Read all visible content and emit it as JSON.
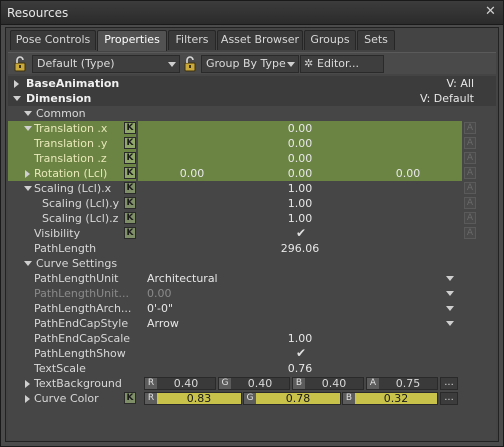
{
  "window": {
    "title": "Resources",
    "close_glyph": "✕"
  },
  "tabs": [
    {
      "label": "Pose Controls",
      "active": false
    },
    {
      "label": "Properties",
      "active": true
    },
    {
      "label": "Filters",
      "active": false
    },
    {
      "label": "Asset Browser",
      "active": false
    },
    {
      "label": "Groups",
      "active": false
    },
    {
      "label": "Sets",
      "active": false
    }
  ],
  "toolbar": {
    "filter_combo": "Default (Type)",
    "group_combo": "Group By Type",
    "editor_label": "Editor..."
  },
  "grid": {
    "base_animation": {
      "label": "BaseAnimation",
      "value": "V: All"
    },
    "dimension": {
      "label": "Dimension",
      "value": "V: Default"
    },
    "common_label": "Common",
    "translation_x": {
      "label": "Translation .x",
      "value": "0.00"
    },
    "translation_y": {
      "label": "Translation .y",
      "value": "0.00"
    },
    "translation_z": {
      "label": "Translation .z",
      "value": "0.00"
    },
    "rotation": {
      "label": "Rotation (Lcl)",
      "values": [
        "0.00",
        "0.00",
        "0.00"
      ]
    },
    "scaling_x": {
      "label": "Scaling (Lcl).x",
      "value": "1.00"
    },
    "scaling_y": {
      "label": "Scaling (Lcl).y",
      "value": "1.00"
    },
    "scaling_z": {
      "label": "Scaling (Lcl).z",
      "value": "1.00"
    },
    "visibility": {
      "label": "Visibility",
      "checked": true,
      "glyph": "✔"
    },
    "path_length": {
      "label": "PathLength",
      "value": "296.06"
    },
    "curve_settings_label": "Curve Settings",
    "path_length_unit": {
      "label": "PathLengthUnit",
      "value": "Architectural"
    },
    "path_length_unit_dim": {
      "label": "PathLengthUnit...",
      "value": "0.00"
    },
    "path_length_arch": {
      "label": "PathLengthArch...",
      "value": "0'-0\""
    },
    "path_end_cap_style": {
      "label": "PathEndCapStyle",
      "value": "Arrow"
    },
    "path_end_cap_scale": {
      "label": "PathEndCapScale",
      "value": "1.00"
    },
    "path_length_show": {
      "label": "PathLengthShow",
      "checked": true,
      "glyph": "✔"
    },
    "text_scale": {
      "label": "TextScale",
      "value": "0.76"
    },
    "text_background": {
      "label": "TextBackground",
      "channels": [
        {
          "ch": "R",
          "value": "0.40"
        },
        {
          "ch": "G",
          "value": "0.40"
        },
        {
          "ch": "B",
          "value": "0.40"
        },
        {
          "ch": "A",
          "value": "0.75"
        }
      ]
    },
    "curve_color": {
      "label": "Curve Color",
      "channels": [
        {
          "ch": "R",
          "value": "0.83"
        },
        {
          "ch": "G",
          "value": "0.78"
        },
        {
          "ch": "B",
          "value": "0.32"
        }
      ]
    },
    "key_letter": "K",
    "anim_letter": "A",
    "more_label": "..."
  },
  "colors": {
    "animated_row": "#6b8444",
    "key_box": "#8fa86a",
    "curve_color_swatch": "#c8c24a",
    "panel_bg": "#464646"
  }
}
